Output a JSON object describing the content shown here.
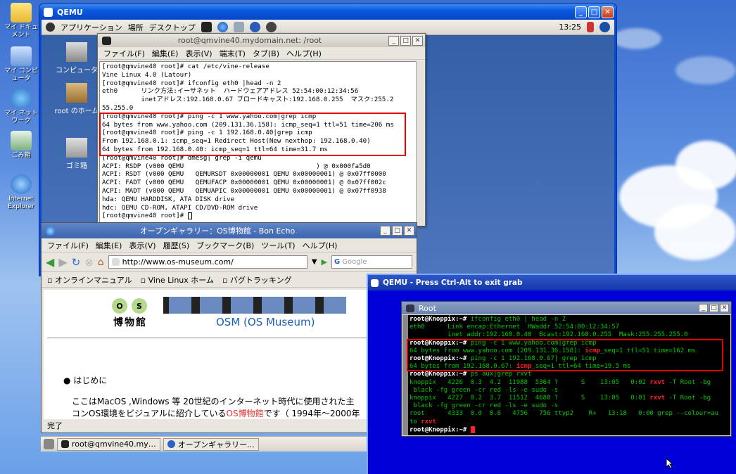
{
  "host_desktop": {
    "icons": [
      {
        "label": "マイ ドキュメント",
        "icon": "folder-icon"
      },
      {
        "label": "マイ コンピュータ",
        "icon": "computer-icon"
      },
      {
        "label": "マイ ネットワーク",
        "icon": "network-icon"
      },
      {
        "label": "ごみ箱",
        "icon": "recycle-bin-icon"
      },
      {
        "label": "Internet Explorer",
        "icon": "internet-explorer-icon"
      }
    ]
  },
  "qemu1": {
    "title": "QEMU",
    "panel": {
      "menus": [
        "アプリケーション",
        "場所",
        "デスクトップ"
      ],
      "clock": "13:25"
    },
    "desktop_icons": [
      "コンピュータ",
      "root のホーム",
      "ゴミ箱"
    ],
    "terminal": {
      "title": "root@qmvine40.mydomain.net: /root",
      "menu": [
        "ファイル(F)",
        "編集(E)",
        "表示(V)",
        "端末(T)",
        "タブ(B)",
        "ヘルプ(H)"
      ],
      "lines": [
        "[root@qmvine40 root]# cat /etc/vine-release",
        "Vine Linux 4.0 (Latour)",
        "[root@qmvine40 root]# ifconfig eth0 |head -n 2",
        "eth0      リンク方法:イーサネット  ハードウェアアドレス 52:54:00:12:34:56",
        "          inetアドレス:192.168.0.67 ブロードキャスト:192.168.0.255  マスク:255.2",
        "55.255.0",
        "[root@qmvine40 root]# ping -c 1 www.yahoo.com|grep icmp",
        "64 bytes from www.yahoo.com (209.131.36.158): icmp_seq=1 ttl=51 time=206 ms",
        "[root@qmvine40 root]# ping -c 1 192.168.0.40|grep icmp",
        "From 192.168.0.1: icmp_seq=1 Redirect Host(New nexthop: 192.168.0.40)",
        "64 bytes from 192.168.0.40: icmp_seq=1 ttl=64 time=31.7 ms",
        "[root@qmvine40 root]# dmesg| grep -i qemu",
        "ACPI: RSDP (v000 QEMU                                  ) @ 0x000fa5d0",
        "ACPI: RSDT (v000 QEMU   QEMURSDT 0x00000001 QEMU 0x00000001) @ 0x07ff0000",
        "ACPI: FADT (v000 QEMU   QEMUFACP 0x00000001 QEMU 0x00000001) @ 0x07ff002c",
        "ACPI: MADT (v000 QEMU   QEMUAPIC 0x00000001 QEMU 0x00000001) @ 0x07ff0938",
        "hda: QEMU HARDDISK, ATA DISK drive",
        "hdc: QEMU CD-ROM, ATAPI CD/DVD-ROM drive",
        "[root@qmvine40 root]# "
      ]
    },
    "browser": {
      "title": "オープンギャラリー：OS博物館 - Bon Echo",
      "menu": [
        "ファイル(F)",
        "編集(E)",
        "表示(V)",
        "履歴(S)",
        "ブックマーク(B)",
        "ツール(T)",
        "ヘルプ(H)"
      ],
      "url": "http://www.os-museum.com/",
      "search_placeholder": "Google",
      "bookmarks": [
        "オンラインマニュアル",
        "Vine Linux ホーム",
        "バグトラッキング"
      ],
      "logo_chars": [
        "O",
        "S",
        "博",
        "物",
        "館"
      ],
      "site_title": "OSM (OS Museum)",
      "bullet": "はじめに",
      "para1": "ここはMacOS ,Windows 等 20世紀のインターネット時代に使用された主",
      "para2a": "コンOS環境をビジュアルに紹介している",
      "para2link": "OS博物館",
      "para2b": "です（ 1994年〜2000年",
      "status": "完了"
    },
    "taskbar": [
      "root@qmvine40.my…",
      "オープンギャラリー..."
    ]
  },
  "qemu2": {
    "title": "QEMU - Press Ctrl-Alt to exit grab",
    "root_title": "Root",
    "lines": [
      [
        {
          "t": "root@Knoppix:~# ",
          "c": "b"
        },
        {
          "t": "ifconfig eth0 | head -n 2",
          "c": "g"
        }
      ],
      [
        {
          "t": "eth0      Link encap:Ethernet  HWaddr 52:54:00:12:34:57",
          "c": "g"
        }
      ],
      [
        {
          "t": "          inet addr:192.168.0.40  Bcast:192.168.0.255  Mask:255.255.255.0",
          "c": "g"
        }
      ],
      [
        {
          "t": "root@Knoppix:~# ",
          "c": "b"
        },
        {
          "t": "ping -c 1 www.yahoo.com|grep icmp",
          "c": "g"
        }
      ],
      [
        {
          "t": "64 bytes from www.yahoo.com (209.131.36.158): ",
          "c": "g"
        },
        {
          "t": "icmp",
          "c": "rb"
        },
        {
          "t": "_seq=1 ttl=51 time=162 ms",
          "c": "g"
        }
      ],
      [
        {
          "t": "root@Knoppix:~# ",
          "c": "b"
        },
        {
          "t": "ping -c 1 192.168.0.67| grep icmp",
          "c": "g"
        }
      ],
      [
        {
          "t": "64 bytes from 192.168.0.67: ",
          "c": "g"
        },
        {
          "t": "icmp",
          "c": "rb"
        },
        {
          "t": "_seq=1 ttl=64 time=19.5 ms",
          "c": "g"
        }
      ],
      [
        {
          "t": "root@Knoppix:~# ",
          "c": "b"
        },
        {
          "t": "ps aux|grep rxvt",
          "c": "g"
        }
      ],
      [
        {
          "t": "knoppix   4226  0.3  4.2  11988  5364 ?      S    13:05   0:02 ",
          "c": "g"
        },
        {
          "t": "rxvt",
          "c": "rb"
        },
        {
          "t": " -T Root -bg",
          "c": "g"
        }
      ],
      [
        {
          "t": " black -fg green -cr red -ls -e sudo -s",
          "c": "g"
        }
      ],
      [
        {
          "t": "knoppix   4227  0.2  3.7  11512  4680 ?      S    13:05   0:01 ",
          "c": "g"
        },
        {
          "t": "rxvt",
          "c": "rb"
        },
        {
          "t": " -T Root -bg",
          "c": "g"
        }
      ],
      [
        {
          "t": " black -fg green -cr red -ls -e sudo -s",
          "c": "g"
        }
      ],
      [
        {
          "t": "root      4333  0.0  0.6   4756   756 ttyp2    R+   13:18   0:00 grep --colour=au",
          "c": "g"
        }
      ],
      [
        {
          "t": "to ",
          "c": "g"
        },
        {
          "t": "rxvt",
          "c": "rb"
        }
      ],
      [
        {
          "t": "root@Knoppix:~# ",
          "c": "b"
        }
      ]
    ]
  },
  "colors": {
    "highlight": "#e00000",
    "term_green": "#00c800",
    "qemu_blue": "#0000d8",
    "xp_title": "#0a58e0"
  }
}
